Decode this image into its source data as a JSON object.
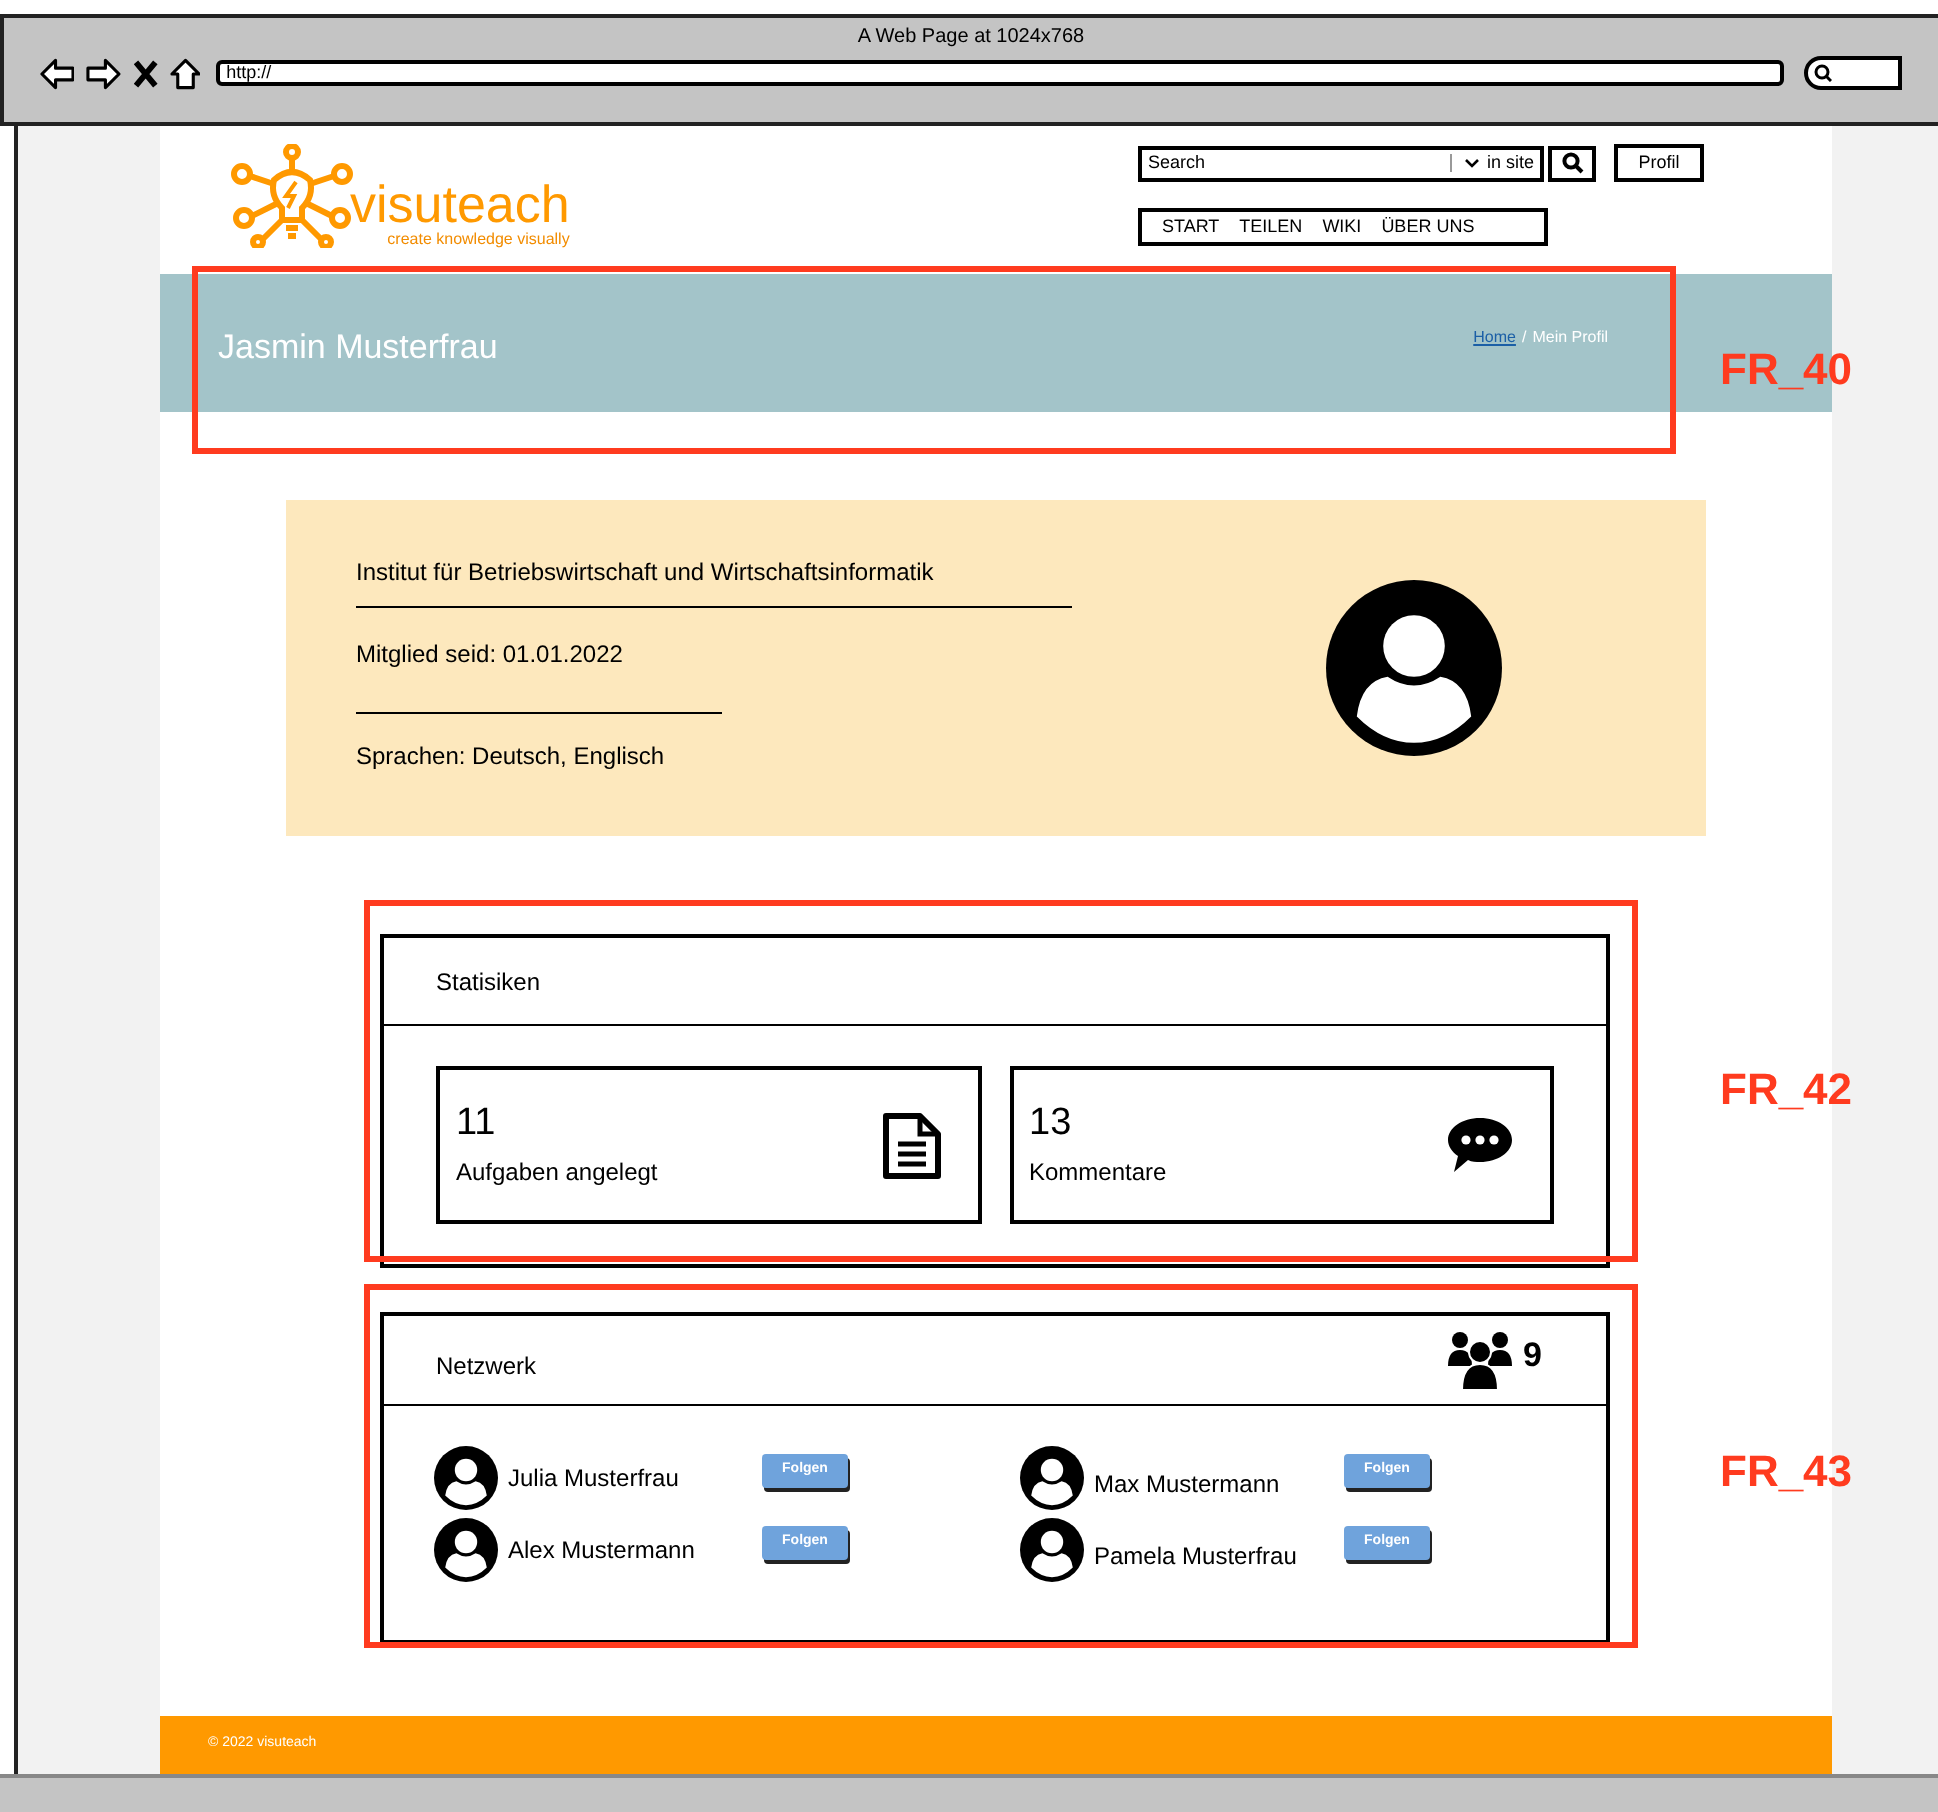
{
  "browser": {
    "title": "A Web Page at 1024x768",
    "url": "http://"
  },
  "header": {
    "logo": {
      "name": "visuteach",
      "tagline": "create knowledge visually"
    },
    "search": {
      "placeholder": "Search",
      "scope": "in site"
    },
    "profile_button": "Profil",
    "nav": [
      "START",
      "TEILEN",
      "WIKI",
      "ÜBER UNS"
    ]
  },
  "banner": {
    "title": "Jasmin Musterfrau",
    "breadcrumb": [
      {
        "label": "Home",
        "kind": "link"
      },
      {
        "label": "Mein Profil",
        "kind": "current"
      }
    ],
    "separator": "/"
  },
  "profile": {
    "lines": [
      "Institut für Betriebswirtschaft und Wirtschaftsinformatik",
      "Mitglied seid: 01.01.2022",
      "Sprachen: Deutsch, Englisch"
    ]
  },
  "stats": {
    "title": "Statisiken",
    "items": [
      {
        "value": "11",
        "label": "Aufgaben angelegt",
        "kind": "document"
      },
      {
        "value": "13",
        "label": "Kommentare",
        "kind": "comment"
      }
    ]
  },
  "network": {
    "title": "Netzwerk",
    "count": "9",
    "people": [
      {
        "name": "Julia Musterfrau",
        "button": "Folgen"
      },
      {
        "name": "Max Mustermann",
        "button": "Folgen"
      },
      {
        "name": "Alex Mustermann",
        "button": "Folgen"
      },
      {
        "name": "Pamela Musterfrau",
        "button": "Folgen"
      }
    ]
  },
  "footer": {
    "text": "© 2022 visuteach"
  },
  "annotations": [
    {
      "label": "FR_40"
    },
    {
      "label": "FR_42"
    },
    {
      "label": "FR_43"
    }
  ]
}
